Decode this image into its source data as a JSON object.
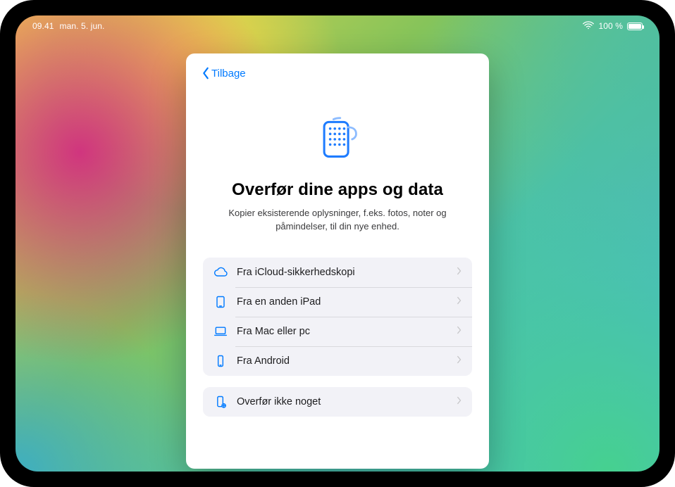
{
  "status": {
    "time": "09.41",
    "date": "man. 5. jun.",
    "battery_pct": "100 %"
  },
  "back_label": "Tilbage",
  "title": "Overfør dine apps og data",
  "subtitle": "Kopier eksisterende oplysninger, f.eks. fotos, noter og påmindelser, til din nye enhed.",
  "options": [
    {
      "icon": "cloud-icon",
      "label": "Fra iCloud-sikkerhedskopi"
    },
    {
      "icon": "ipad-icon",
      "label": "Fra en anden iPad"
    },
    {
      "icon": "laptop-icon",
      "label": "Fra Mac eller pc"
    },
    {
      "icon": "phone-icon",
      "label": "Fra Android"
    }
  ],
  "skip_option": {
    "icon": "device-plus-icon",
    "label": "Overfør ikke noget"
  }
}
